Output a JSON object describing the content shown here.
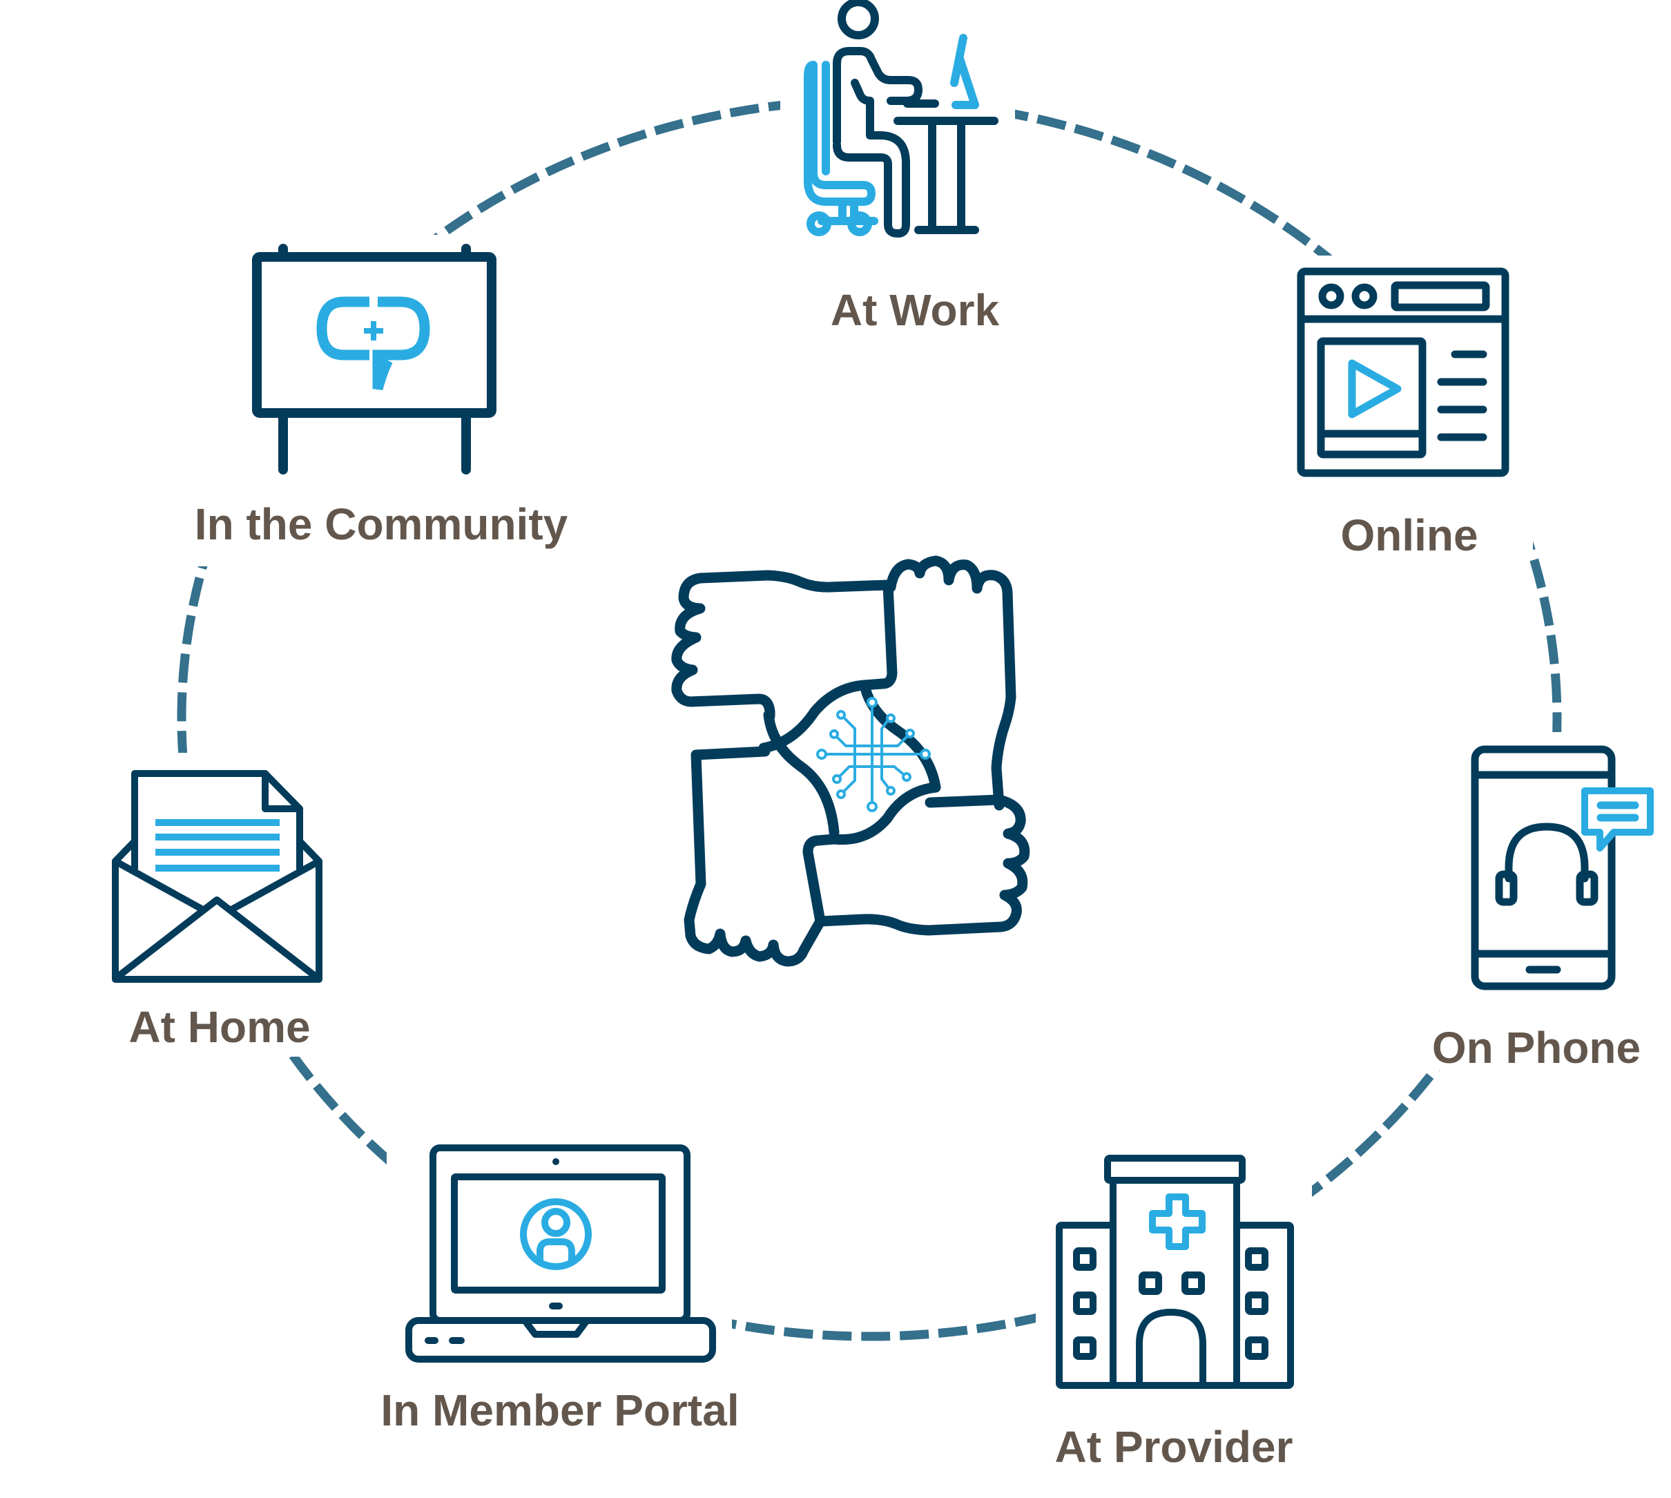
{
  "diagram": {
    "title": "",
    "colors": {
      "primary_navy": "#033c5a",
      "accent_blue": "#2aace2",
      "ring_dash": "#35708c",
      "label_text": "#63574d",
      "background": "#ffffff"
    },
    "center": {
      "icon": "hands-circuit-icon",
      "description": "four interlocked hands around a circuit symbol"
    },
    "ring": {
      "style": "dashed",
      "shape": "ellipse"
    },
    "nodes": [
      {
        "id": "at-work",
        "label": "At Work",
        "icon": "person-at-desk-icon",
        "position": "top"
      },
      {
        "id": "online",
        "label": "Online",
        "icon": "browser-video-icon",
        "position": "top-right"
      },
      {
        "id": "on-phone",
        "label": "On Phone",
        "icon": "phone-headset-chat-icon",
        "position": "right"
      },
      {
        "id": "at-provider",
        "label": "At Provider",
        "icon": "hospital-icon",
        "position": "bottom-right"
      },
      {
        "id": "in-member-portal",
        "label": "In Member Portal",
        "icon": "laptop-user-icon",
        "position": "bottom-left"
      },
      {
        "id": "at-home",
        "label": "At Home",
        "icon": "open-envelope-icon",
        "position": "left"
      },
      {
        "id": "in-the-community",
        "label": "In the Community",
        "icon": "billboard-icon",
        "position": "top-left"
      }
    ]
  }
}
